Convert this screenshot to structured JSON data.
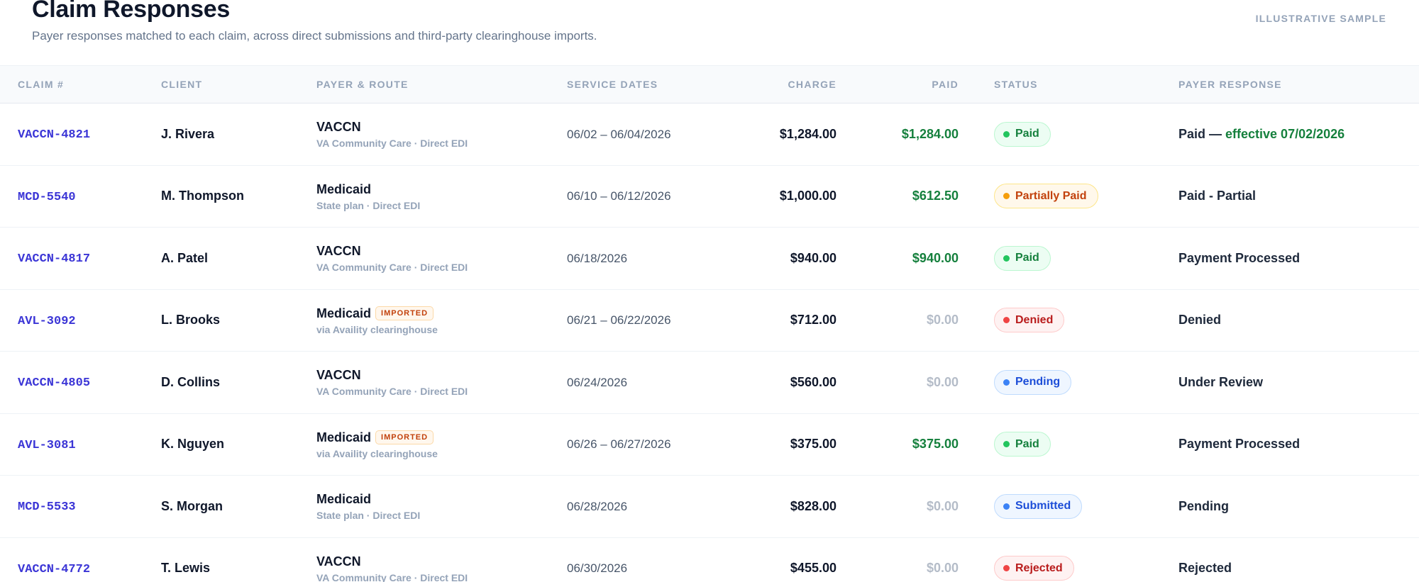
{
  "header": {
    "title": "Claim Responses",
    "subtitle": "Payer responses matched to each claim, across direct submissions and third-party clearinghouse imports.",
    "sample_label": "ILLUSTRATIVE SAMPLE"
  },
  "columns": {
    "claim": "CLAIM #",
    "client": "CLIENT",
    "payer": "PAYER & ROUTE",
    "dates": "SERVICE DATES",
    "charge": "CHARGE",
    "paid": "PAID",
    "status": "STATUS",
    "response": "PAYER RESPONSE"
  },
  "colors": {
    "claim_link": "#3b35d6",
    "paid_green": "#15803d",
    "status_paid": "#22c55e",
    "status_partial": "#f59e0b",
    "status_denied": "#ef4444",
    "status_pending": "#3b82f6"
  },
  "rows": [
    {
      "claim": "VACCN-4821",
      "client": "J. Rivera",
      "payer": "VACCN",
      "imported": "",
      "route": "VA Community Care · Direct EDI",
      "dates": "06/02 – 06/04/2026",
      "charge": "$1,284.00",
      "paid": "$1,284.00",
      "paid_zero": false,
      "status": "Paid",
      "status_color": "green",
      "response": "Paid — ",
      "response_highlight": "effective 07/02/2026"
    },
    {
      "claim": "MCD-5540",
      "client": "M. Thompson",
      "payer": "Medicaid",
      "imported": "",
      "route": "State plan · Direct EDI",
      "dates": "06/10 – 06/12/2026",
      "charge": "$1,000.00",
      "paid": "$612.50",
      "paid_zero": false,
      "status": "Partially Paid",
      "status_color": "orange",
      "response": "Paid - Partial",
      "response_highlight": ""
    },
    {
      "claim": "VACCN-4817",
      "client": "A. Patel",
      "payer": "VACCN",
      "imported": "",
      "route": "VA Community Care · Direct EDI",
      "dates": "06/18/2026",
      "charge": "$940.00",
      "paid": "$940.00",
      "paid_zero": false,
      "status": "Paid",
      "status_color": "green",
      "response": "Payment Processed",
      "response_highlight": ""
    },
    {
      "claim": "AVL-3092",
      "client": "L. Brooks",
      "payer": "Medicaid",
      "imported": "IMPORTED",
      "route": "via Availity clearinghouse",
      "dates": "06/21 – 06/22/2026",
      "charge": "$712.00",
      "paid": "$0.00",
      "paid_zero": true,
      "status": "Denied",
      "status_color": "red",
      "response": "Denied",
      "response_highlight": ""
    },
    {
      "claim": "VACCN-4805",
      "client": "D. Collins",
      "payer": "VACCN",
      "imported": "",
      "route": "VA Community Care · Direct EDI",
      "dates": "06/24/2026",
      "charge": "$560.00",
      "paid": "$0.00",
      "paid_zero": true,
      "status": "Pending",
      "status_color": "blue",
      "response": "Under Review",
      "response_highlight": ""
    },
    {
      "claim": "AVL-3081",
      "client": "K. Nguyen",
      "payer": "Medicaid",
      "imported": "IMPORTED",
      "route": "via Availity clearinghouse",
      "dates": "06/26 – 06/27/2026",
      "charge": "$375.00",
      "paid": "$375.00",
      "paid_zero": false,
      "status": "Paid",
      "status_color": "green",
      "response": "Payment Processed",
      "response_highlight": ""
    },
    {
      "claim": "MCD-5533",
      "client": "S. Morgan",
      "payer": "Medicaid",
      "imported": "",
      "route": "State plan · Direct EDI",
      "dates": "06/28/2026",
      "charge": "$828.00",
      "paid": "$0.00",
      "paid_zero": true,
      "status": "Submitted",
      "status_color": "blue",
      "response": "Pending",
      "response_highlight": ""
    },
    {
      "claim": "VACCN-4772",
      "client": "T. Lewis",
      "payer": "VACCN",
      "imported": "",
      "route": "VA Community Care · Direct EDI",
      "dates": "06/30/2026",
      "charge": "$455.00",
      "paid": "$0.00",
      "paid_zero": true,
      "status": "Rejected",
      "status_color": "red",
      "response": "Rejected",
      "response_highlight": ""
    }
  ]
}
